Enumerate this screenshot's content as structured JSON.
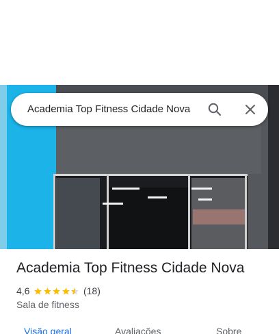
{
  "search": {
    "query": "Academia Top Fitness Cidade Nova"
  },
  "place": {
    "title": "Academia Top Fitness Cidade Nova",
    "rating": "4,6",
    "stars": 4.5,
    "review_count": "(18)",
    "category": "Sala de fitness"
  },
  "tabs": [
    {
      "label": "Visão geral"
    },
    {
      "label": "Avaliações"
    },
    {
      "label": "Sobre"
    }
  ],
  "colors": {
    "accent": "#1a73e8",
    "star": "#fbbc04"
  },
  "icons": [
    "search-icon",
    "close-icon",
    "star-icon"
  ]
}
